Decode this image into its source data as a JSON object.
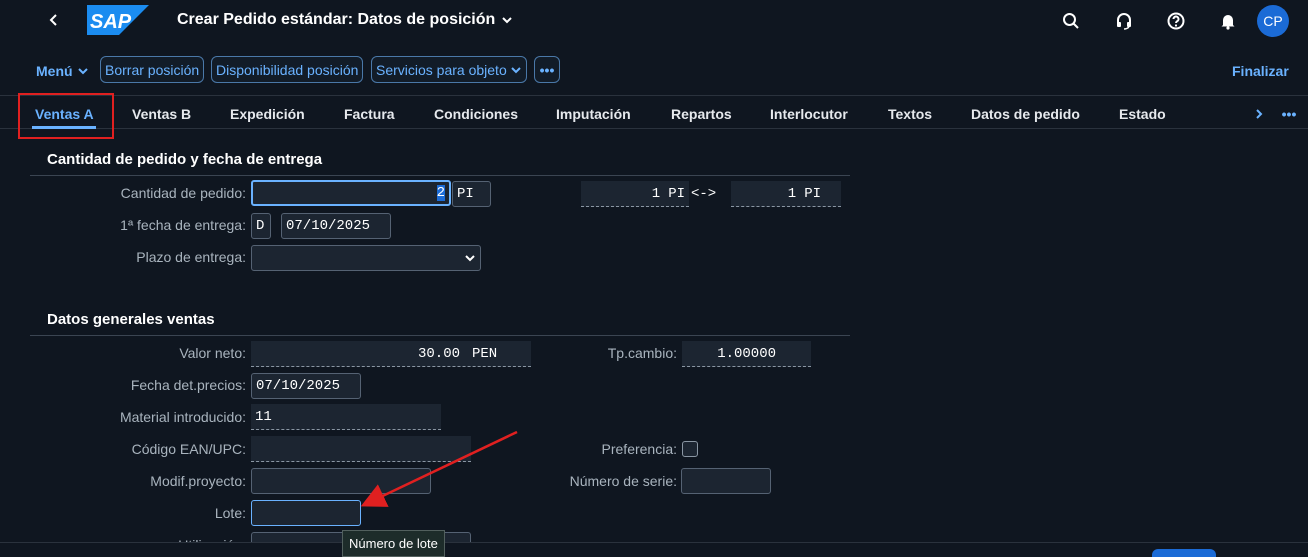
{
  "shell": {
    "title": "Crear Pedido estándar: Datos de posición",
    "logo_text": "SAP",
    "avatar_initials": "CP",
    "icons": [
      "search-icon",
      "headset-icon",
      "help-icon",
      "bell-icon"
    ]
  },
  "toolbar": {
    "menu_label": "Menú",
    "delete_item_label": "Borrar posición",
    "availability_label": "Disponibilidad posición",
    "services_label": "Servicios para objeto",
    "more_label": "•••",
    "finalize_label": "Finalizar"
  },
  "tabs": [
    {
      "label": "Ventas A",
      "active": true
    },
    {
      "label": "Ventas B"
    },
    {
      "label": "Expedición"
    },
    {
      "label": "Factura"
    },
    {
      "label": "Condiciones"
    },
    {
      "label": "Imputación"
    },
    {
      "label": "Repartos"
    },
    {
      "label": "Interlocutor"
    },
    {
      "label": "Textos"
    },
    {
      "label": "Datos de pedido"
    },
    {
      "label": "Estado"
    }
  ],
  "section1": {
    "title": "Cantidad de pedido y fecha de entrega",
    "order_qty_label": "Cantidad de pedido:",
    "order_qty_value": "2",
    "order_qty_unit": "PI",
    "conv_left_value": "1",
    "conv_left_unit": "PI",
    "conv_arrow": "<->",
    "conv_right_value": "1",
    "conv_right_unit": "PI",
    "first_delivery_label": "1ª fecha de entrega:",
    "first_delivery_type": "D",
    "first_delivery_date": "07/10/2025",
    "delivery_time_label": "Plazo de entrega:",
    "delivery_time_value": ""
  },
  "section2": {
    "title": "Datos generales ventas",
    "net_value_label": "Valor neto:",
    "net_value": "30.00",
    "currency": "PEN",
    "exchange_label": "Tp.cambio:",
    "exchange_value": "1.00000",
    "pricing_date_label": "Fecha det.precios:",
    "pricing_date": "07/10/2025",
    "material_label": "Material introducido:",
    "material_value": "11",
    "ean_label": "Código EAN/UPC:",
    "ean_value": "",
    "preference_label": "Preferencia:",
    "project_label": "Modif.proyecto:",
    "project_value": "",
    "serial_label": "Número de serie:",
    "serial_value": "",
    "batch_label": "Lote:",
    "batch_value": "",
    "usage_label": "Utilización:"
  },
  "tooltip": "Número de lote",
  "colors": {
    "accent": "#6ab2ff",
    "background": "#0f1620",
    "highlight_box": "#e02020",
    "annotation_arrow": "#e02020"
  }
}
